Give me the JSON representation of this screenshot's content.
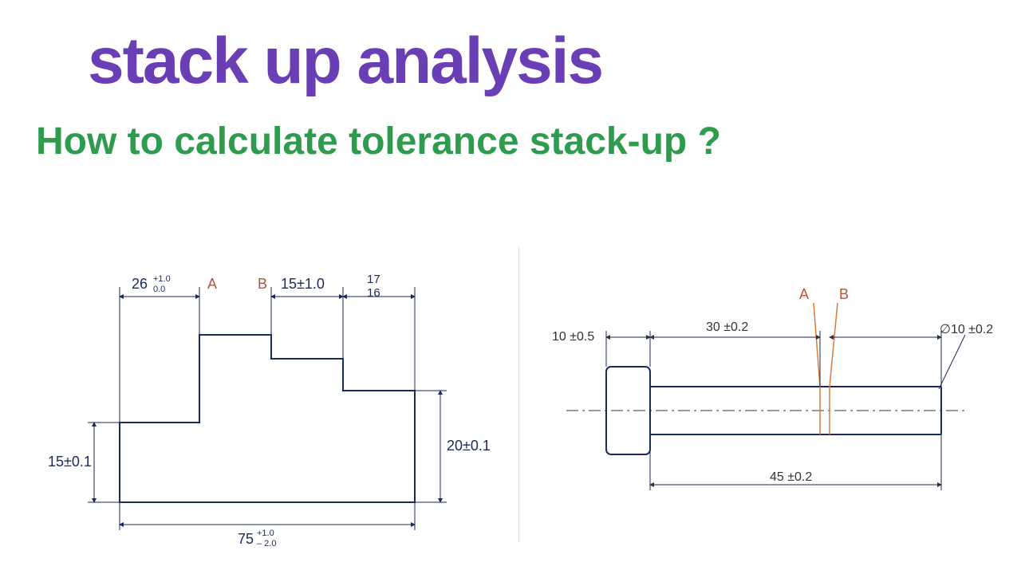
{
  "title": "stack up analysis",
  "subtitle": "How to calculate tolerance stack-up ?",
  "left_diagram": {
    "dim1": {
      "base": "26",
      "upper": "+1.0",
      "lower": "0.0"
    },
    "ann_a": "A",
    "ann_b": "B",
    "dim2": "15±1.0",
    "dim3_top": "17",
    "dim3_bot": "16",
    "dim_left": "15±0.1",
    "dim_right": "20±0.1",
    "dim_bottom": {
      "base": "75",
      "upper": "+1.0",
      "lower": "– 2.0"
    }
  },
  "right_diagram": {
    "ann_a": "A",
    "ann_b": "B",
    "dim_left": "10 ±0.5",
    "dim_mid": "30 ±0.2",
    "dim_diam": "∅10 ±0.2",
    "dim_bottom": "45 ±0.2"
  }
}
